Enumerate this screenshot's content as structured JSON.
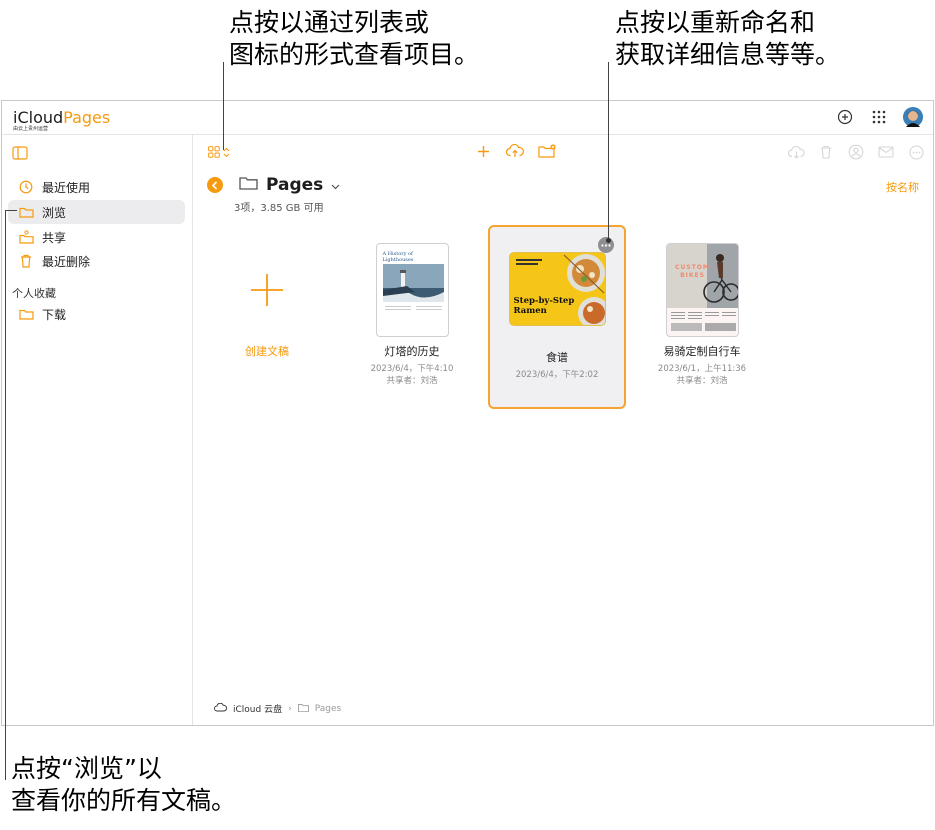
{
  "callouts": {
    "view_mode": [
      "点按以通过列表或",
      "图标的形式查看项目。"
    ],
    "more": [
      "点按以重新命名和",
      "获取详细信息等等。"
    ],
    "browse": [
      "点按“浏览”以",
      "查看你的所有文稿。"
    ]
  },
  "app": {
    "brand_icloud": "iCloud",
    "brand_pages": "Pages",
    "brand_sub": "由云上贵州运营"
  },
  "sidebar": {
    "items": [
      {
        "label": "最近使用",
        "icon": "clock-icon"
      },
      {
        "label": "浏览",
        "icon": "folder-icon"
      },
      {
        "label": "共享",
        "icon": "shared-folder-icon"
      },
      {
        "label": "最近删除",
        "icon": "trash-icon"
      }
    ],
    "section_title": "个人收藏",
    "favorites": [
      {
        "label": "下载",
        "icon": "folder-icon"
      }
    ]
  },
  "main": {
    "folder_title": "Pages",
    "folder_meta": "3项，3.85 GB 可用",
    "sort_label": "按名称",
    "create_label": "创建文稿",
    "documents": [
      {
        "name": "灯塔的历史",
        "date": "2023/6/4，下午4:10",
        "shared": "共享者：刘浩",
        "thumb_title": "A History of Lighthouses"
      },
      {
        "name": "食谱",
        "date": "2023/6/4，下午2:02",
        "shared": "",
        "thumb_title": "Step-by-Step Ramen"
      },
      {
        "name": "易骑定制自行车",
        "date": "2023/6/1，上午11:36",
        "shared": "共享者：刘浩",
        "thumb_title": "CUSTOM BIKES"
      }
    ],
    "path": {
      "root": "iCloud 云盘",
      "current": "Pages"
    }
  },
  "colors": {
    "accent": "#f79a0e",
    "selection_border": "#f5a431",
    "sidebar_active": "#ececee"
  }
}
